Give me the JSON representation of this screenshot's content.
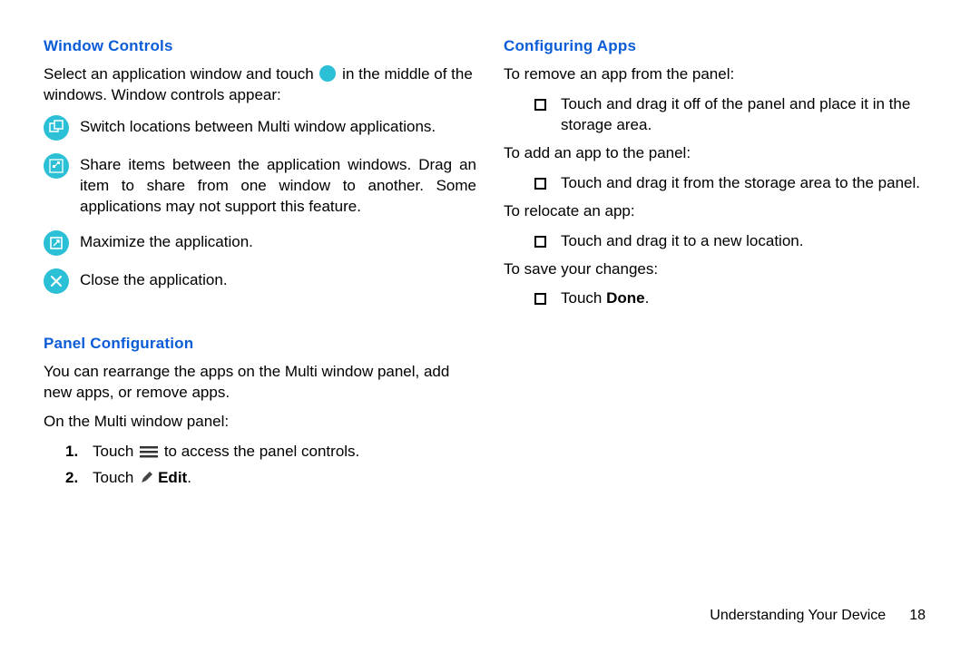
{
  "left": {
    "heading1": "Window Controls",
    "intro_a": "Select an application window and touch ",
    "intro_b": " in the middle of the windows. Window controls appear:",
    "rows": [
      {
        "text": "Switch locations between Multi window applications."
      },
      {
        "text": "Share items between the application windows. Drag an item to share from one window to another. Some applications may not support this feature."
      },
      {
        "text": "Maximize the application."
      },
      {
        "text": "Close the application."
      }
    ],
    "heading2": "Panel Configuration",
    "panel_intro": "You can rearrange the apps on the Multi window panel, add new apps, or remove apps.",
    "panel_sub": "On the Multi window panel:",
    "step1_a": "Touch ",
    "step1_b": " to access the panel controls.",
    "step2_a": "Touch ",
    "step2_b": "Edit",
    "step2_c": ".",
    "num1": "1.",
    "num2": "2."
  },
  "right": {
    "heading": "Configuring Apps",
    "p1": "To remove an app from the panel:",
    "b1": "Touch and drag it off of the panel and place it in the storage area.",
    "p2": "To add an app to the panel:",
    "b2": "Touch and drag it from the storage area to the panel.",
    "p3": "To relocate an app:",
    "b3": "Touch and drag it to a new location.",
    "p4": "To save your changes:",
    "b4_a": "Touch ",
    "b4_b": "Done",
    "b4_c": "."
  },
  "footer": {
    "section": "Understanding Your Device",
    "page": "18"
  }
}
